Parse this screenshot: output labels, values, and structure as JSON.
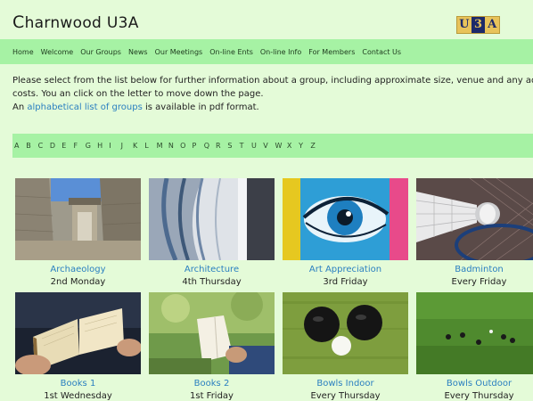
{
  "header": {
    "title_first": "C",
    "title_rest": "harnwood U3A",
    "logo": [
      "U",
      "3",
      "A"
    ]
  },
  "nav": [
    "Home",
    "Welcome",
    "Our Groups",
    "News",
    "Our Meetings",
    "On-line Ents",
    "On-line Info",
    "For Members",
    "Contact Us"
  ],
  "intro": {
    "line1": "Please select from the list below for further information about a group, including approximate size, venue and any additiona",
    "line2": "costs. You an click on the letter to move down the page.",
    "line3_prefix": "An ",
    "line3_link": "alphabetical list of groups",
    "line3_suffix": " is available in pdf format."
  },
  "alphabet": [
    "A",
    "B",
    "C",
    "D",
    "E",
    "F",
    "G",
    "H",
    "I",
    "J",
    "K",
    "L",
    "M",
    "N",
    "O",
    "P",
    "Q",
    "R",
    "S",
    "T",
    "U",
    "V",
    "W",
    "X",
    "Y",
    "Z"
  ],
  "groups": [
    {
      "name": "Archaeology",
      "schedule": "2nd Monday",
      "image": "stone-ruins-image"
    },
    {
      "name": "Architecture",
      "schedule": "4th Thursday",
      "image": "curved-building-image"
    },
    {
      "name": "Art Appreciation",
      "schedule": "3rd Friday",
      "image": "graffiti-eye-image"
    },
    {
      "name": "Badminton",
      "schedule": "Every Friday",
      "image": "shuttlecock-racket-image"
    },
    {
      "name": "Books 1",
      "schedule": "1st Wednesday",
      "image": "open-book-image"
    },
    {
      "name": "Books 2",
      "schedule": "1st Friday",
      "image": "reading-park-image"
    },
    {
      "name": "Bowls Indoor",
      "schedule": "Every Thursday",
      "image": "bowls-balls-image"
    },
    {
      "name": "Bowls Outdoor",
      "schedule": "Every Thursday",
      "image": "bowling-green-image"
    }
  ],
  "colors": {
    "background": "#e4fbd8",
    "nav_bar": "#a6f2a4",
    "link": "#2a7fc0"
  }
}
